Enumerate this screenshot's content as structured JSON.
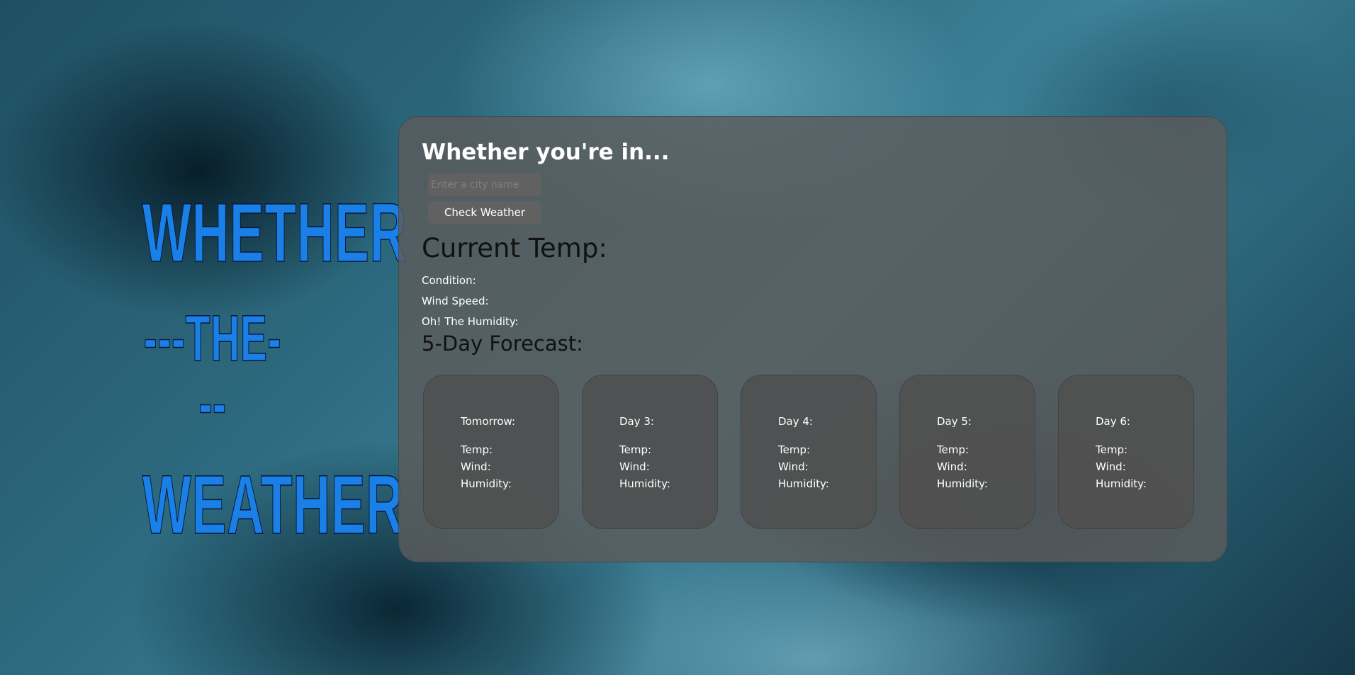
{
  "brand": {
    "line1": "WHETHER",
    "line2": "---THE---",
    "line3": "WEATHER",
    "color": "#1a7fe6"
  },
  "search": {
    "heading": "Whether you're in...",
    "placeholder": "Enter a city name",
    "value": "",
    "button_label": "Check Weather"
  },
  "current": {
    "temp_label": "Current Temp:",
    "condition_label": "Condition:",
    "wind_label": "Wind Speed:",
    "humidity_label": "Oh! The Humidity:"
  },
  "forecast": {
    "heading": "5-Day Forecast:",
    "days": [
      {
        "day": "Tomorrow:",
        "temp": "Temp:",
        "wind": "Wind:",
        "humidity": "Humidity:"
      },
      {
        "day": "Day 3:",
        "temp": "Temp:",
        "wind": "Wind:",
        "humidity": "Humidity:"
      },
      {
        "day": "Day 4:",
        "temp": "Temp:",
        "wind": "Wind:",
        "humidity": "Humidity:"
      },
      {
        "day": "Day 5:",
        "temp": "Temp:",
        "wind": "Wind:",
        "humidity": "Humidity:"
      },
      {
        "day": "Day 6:",
        "temp": "Temp:",
        "wind": "Wind:",
        "humidity": "Humidity:"
      }
    ]
  }
}
